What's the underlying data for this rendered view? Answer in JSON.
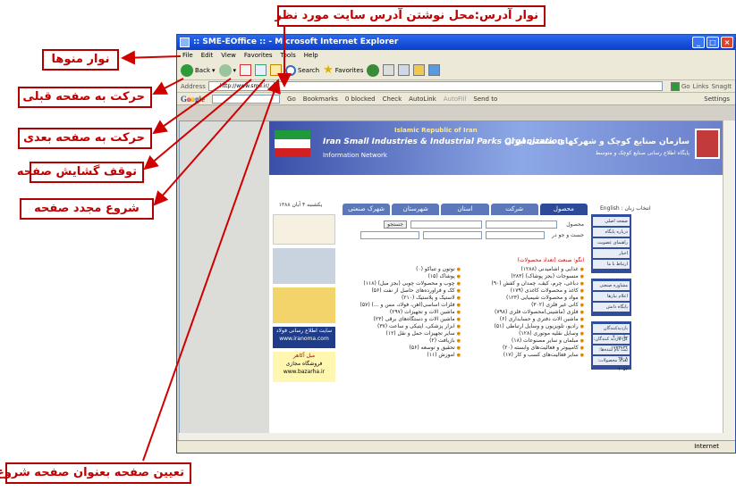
{
  "annotations": {
    "address_bar": "نوار آدرس:محل نوشتن آدرس سایت مورد نظر",
    "menu_bar": "نوار منوها",
    "back": "حرکت به صفحه قبلی",
    "forward": "حرکت به صفحه بعدی",
    "stop": "توقف گشایش صفحه",
    "refresh": "شروع مجدد صفحه",
    "home": "تعیین صفحه بعنوان صفحه شروع"
  },
  "browser": {
    "title": ":: SME-EOffice :: - Microsoft Internet Explorer",
    "menu": [
      "File",
      "Edit",
      "View",
      "Favorites",
      "Tools",
      "Help"
    ],
    "toolbar": {
      "back": "Back",
      "search": "Search",
      "favorites": "Favorites"
    },
    "address_label": "Address",
    "address_value": "http://www.sme.ir/",
    "go": "Go",
    "links": "Links",
    "snagit": "SnagIt",
    "google": {
      "go": "Go",
      "bookmarks": "Bookmarks",
      "blocked": "0 blocked",
      "check": "Check",
      "autolink": "AutoLink",
      "autofill": "AutoFill",
      "sendto": "Send to",
      "settings": "Settings"
    },
    "status": "Internet"
  },
  "page": {
    "banner": {
      "republic": "Islamic Republic of Iran",
      "org": "Iran Small Industries & Industrial Parks Organization",
      "network": "Information Network",
      "org_fa": "سازمان صنایع کوچک و شهرکهای صنعتی ایران",
      "portal_fa": "پایگاه اطلاع رسانی صنایع کوچک و متوسط"
    },
    "tabs": [
      "محصول",
      "شرکت",
      "استان",
      "شهرستان",
      "شهرک صنعتی"
    ],
    "lang": "انتخاب زبان : English",
    "date": "یکشنبه ۴ آبان ۱۳۸۸",
    "search": {
      "label1": "محصول",
      "label2": "جست و جو در",
      "btn": "جستجو"
    },
    "category_head": "انگو: صنعت (تعداد محصولات)",
    "cats_right": [
      "غذایی و آشامیدنی (۱۲۸۸)",
      "منسوجات (بجز پوشاک) (۲۸۳)",
      "دباغی، چرم، کیف، چمدان و کفش (۹۰)",
      "کاغذ و محصولات کاغذی (۱۷۹)",
      "مواد و محصولات شیمیایی (۱۲۳)",
      "کانی غیر فلزی (۳۰۲)",
      "فلزی (ماشینی)محصولات فلزی (۷۹۸)",
      "ماشین آلات دفتری و حسابداری (۶)",
      "رادیو، تلویزیون و وسایل ارتباطی (۵۱)",
      "وسایل نقلیه موتوری (۱۲۸)",
      "مبلمان و سایر مصنوعات (۱۸)",
      "کامپیوتر و فعالیت‌های وابسته (۲۰)",
      "سایر فعالیت‌های کسب و کار (۱۷)"
    ],
    "cats_left": [
      "توتون و تنباکو (۰)",
      "پوشاک (۱۵)",
      "چوب و محصولات چوبی (بجز مبل) (۱۱۸)",
      "کک و فرآورده‌های حاصل از نفت (۵۶)",
      "لاستیک و پلاستیک (۲۱۰)",
      "فلزات اساسی(آهن، فولاد، مس و ...) (۵۷)",
      "ماشین آلات و تجهیزات (۲۹۷)",
      "ماشین آلات و دستگاه‌های برقی (۲۳)",
      "ابزار پزشکی، اپتیکی و ساعت (۳۷)",
      "سایر تجهیزات حمل و نقل (۱۲)",
      "بازیافت (۲)",
      "تحقیق و توسعه (۵۶)",
      "آموزش (۱۱)"
    ],
    "right_menu": [
      "صفحه اصلی",
      "درباره پایگاه",
      "راهنمای عضویت",
      "اخبار",
      "ارتباط با ما"
    ],
    "right_menu2": [
      "مشاوره صنعتی",
      "اعلام نیازها",
      "پایگاه دانش"
    ],
    "right_stats": [
      "بازدیدکنندگان جاری: ۴",
      "کل بازدید کنندگان: ۱۷۲۳۷۳۴",
      "ثبت نام شده‌ها: ۲۵۰۸",
      "تعداد محصولات: ۴۰۵۲"
    ],
    "left_ads": [
      "سایت اطلاع رسانی فولاد",
      "www.iranoma.com",
      "فروشگاه مجازی",
      "www.bazarha.ir",
      "مبل آکاهر"
    ]
  }
}
